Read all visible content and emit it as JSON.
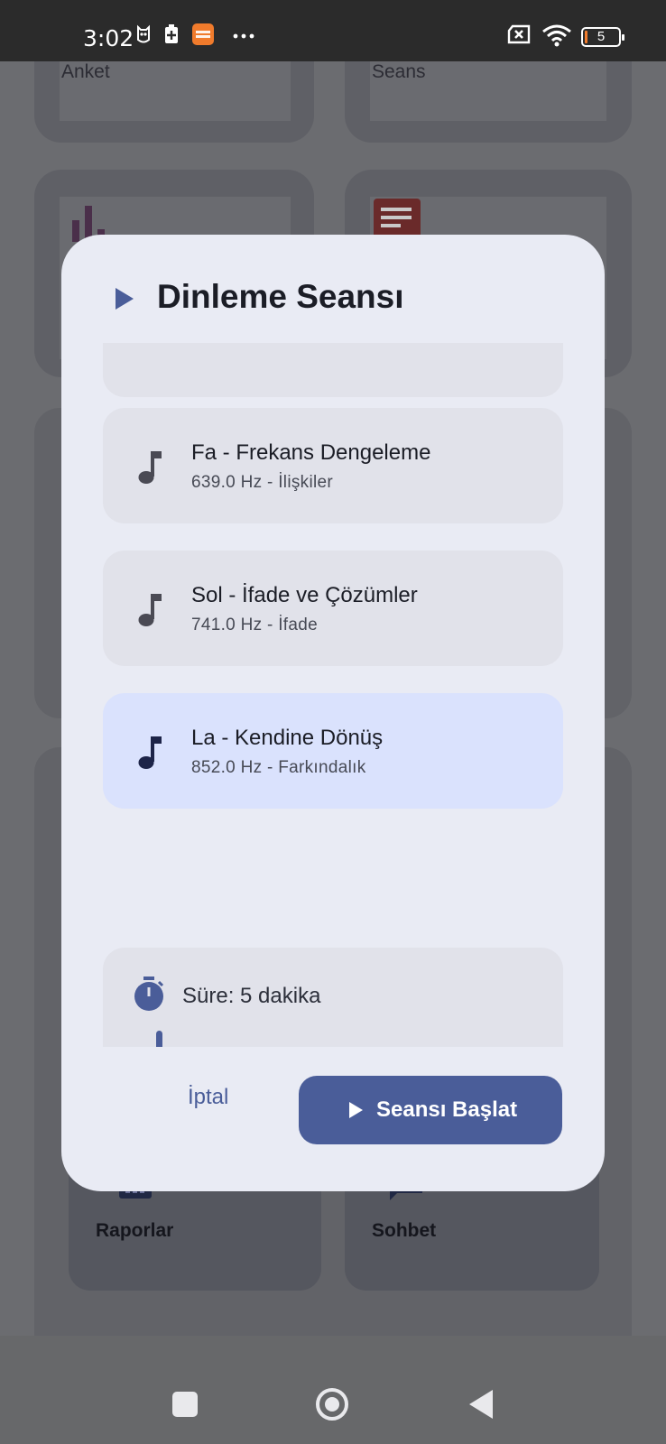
{
  "status_bar": {
    "time": "3:02",
    "battery_level": "5",
    "icons": [
      "owl-icon",
      "battery-saver-icon",
      "temu-app-icon",
      "more-dots-icon",
      "sim-off-icon",
      "wifi-icon",
      "battery-icon"
    ]
  },
  "background": {
    "top_cards": [
      {
        "label": "Anket"
      },
      {
        "label": "Seans"
      }
    ],
    "tiles": [
      {
        "label": "Raporlar",
        "icon": "bar-chart-icon"
      },
      {
        "label": "Sohbet",
        "icon": "chat-icon"
      }
    ]
  },
  "dialog": {
    "title": "Dinleme Seansı",
    "title_icon": "play-icon",
    "frequencies": [
      {
        "title": "Fa - Frekans Dengeleme",
        "subtitle": "639.0 Hz - İlişkiler",
        "selected": false,
        "icon": "music-note-icon"
      },
      {
        "title": "Sol - İfade ve Çözümler",
        "subtitle": "741.0 Hz - İfade",
        "selected": false,
        "icon": "music-note-icon"
      },
      {
        "title": "La - Kendine Dönüş",
        "subtitle": "852.0 Hz - Farkındalık",
        "selected": true,
        "icon": "music-note-icon"
      }
    ],
    "duration": {
      "label": "Süre: 5 dakika",
      "icon": "timer-icon",
      "slider_level": 0
    },
    "cancel_label": "İptal",
    "start_label": "Seansı Başlat"
  },
  "colors": {
    "accent": "#4a5d99",
    "dialog_bg": "#e9ebf4",
    "card_bg": "#e1e2ea",
    "selected_bg": "#dae2fd",
    "scrim": "#6b6c70"
  },
  "navigation_bar": {
    "buttons": [
      "recent-apps-button",
      "home-button",
      "back-button"
    ]
  }
}
